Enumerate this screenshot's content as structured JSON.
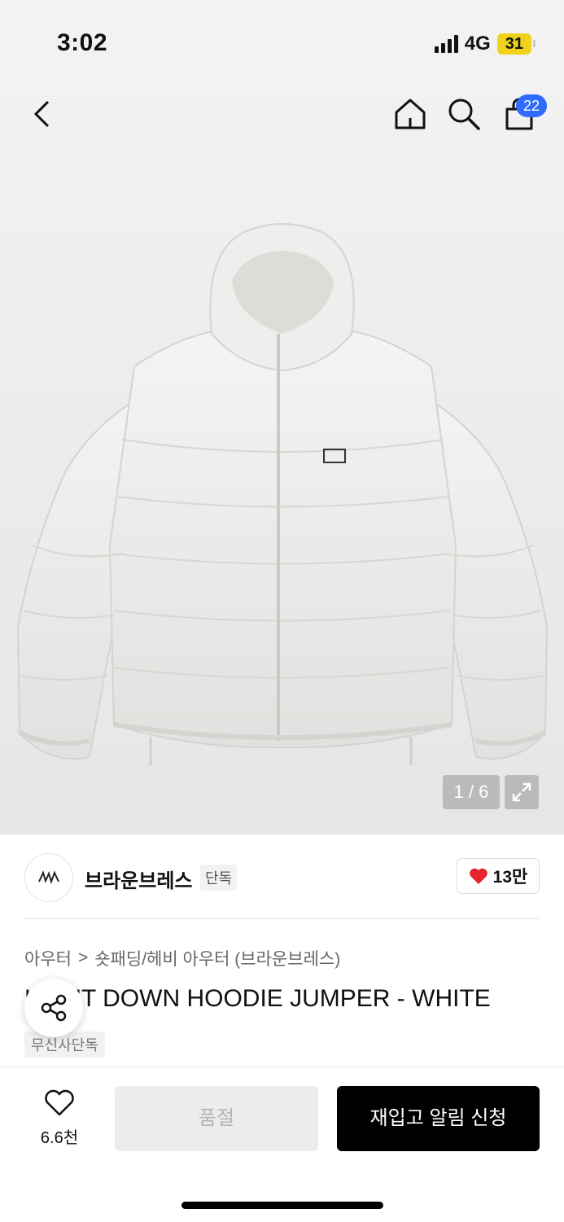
{
  "status": {
    "time": "3:02",
    "network": "4G",
    "battery": "31"
  },
  "header": {
    "cart_count": "22"
  },
  "gallery": {
    "pager": "1 / 6"
  },
  "brand": {
    "name": "브라운브레스",
    "badge": "단독",
    "likes": "13만"
  },
  "breadcrumb": {
    "category": "아우터",
    "separator": ">",
    "subcategory": "숏패딩/헤비 아우터 (브라운브레스)"
  },
  "product": {
    "title": "LIGHT DOWN HOODIE JUMPER - WHITE",
    "exclusive_badge": "무신사단독"
  },
  "bottom": {
    "wish_count": "6.6천",
    "soldout_label": "품절",
    "restock_label": "재입고 알림 신청"
  },
  "colors": {
    "accent": "#2f6bff",
    "heart": "#e8242f",
    "primary_button": "#000000"
  }
}
